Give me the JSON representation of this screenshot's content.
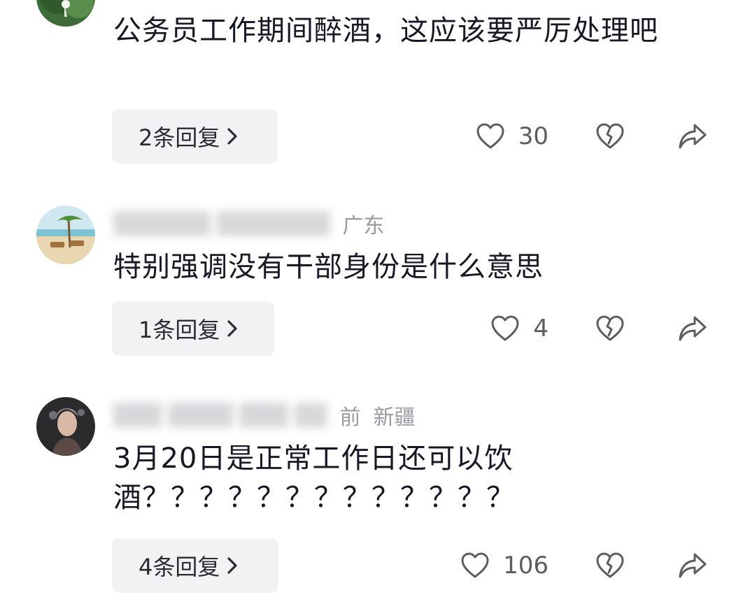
{
  "comments": [
    {
      "author": "",
      "location": "",
      "text": "公务员工作期间醉酒，这应该要严厉处理吧",
      "reply_label": "2条回复",
      "like_count": "30",
      "icons": {
        "like": "heart-outline-icon",
        "dislike": "broken-heart-icon",
        "share": "share-arrow-icon",
        "reply": "chevron-right-icon"
      }
    },
    {
      "author": "",
      "location": "广东",
      "text": "特别强调没有干部身份是什么意思",
      "reply_label": "1条回复",
      "like_count": "4",
      "icons": {
        "like": "heart-outline-icon",
        "dislike": "broken-heart-icon",
        "share": "share-arrow-icon",
        "reply": "chevron-right-icon"
      }
    },
    {
      "author": "",
      "location": "新疆",
      "time": "前",
      "text": "3月20日是正常工作日还可以饮酒？？？？？？？？？？？？？",
      "reply_label": "4条回复",
      "like_count": "106",
      "icons": {
        "like": "heart-outline-icon",
        "dislike": "broken-heart-icon",
        "share": "share-arrow-icon",
        "reply": "chevron-right-icon"
      }
    }
  ],
  "colors": {
    "text": "#161823",
    "meta": "#a3a3a8",
    "reply_bg": "#f2f2f4",
    "icon": "#5c5d63"
  }
}
